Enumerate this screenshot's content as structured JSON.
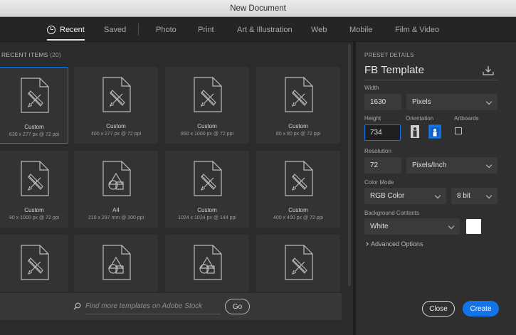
{
  "window": {
    "title": "New Document"
  },
  "tabs": [
    {
      "label": "Recent",
      "active": true
    },
    {
      "label": "Saved"
    },
    {
      "label": "Photo"
    },
    {
      "label": "Print"
    },
    {
      "label": "Art & Illustration"
    },
    {
      "label": "Web"
    },
    {
      "label": "Mobile"
    },
    {
      "label": "Film & Video"
    }
  ],
  "recent": {
    "header": "RECENT ITEMS",
    "count": "(20)",
    "items": [
      {
        "name": "Custom",
        "size": "630 x 277 px @ 72 ppi",
        "icon": "custom-doc-icon",
        "selected": true
      },
      {
        "name": "Custom",
        "size": "400 x 277 px @ 72 ppi",
        "icon": "custom-doc-icon"
      },
      {
        "name": "Custom",
        "size": "850 x 1000 px @ 72 ppi",
        "icon": "custom-doc-icon"
      },
      {
        "name": "Custom",
        "size": "80 x 80 px @ 72 ppi",
        "icon": "custom-doc-icon"
      },
      {
        "name": "Custom",
        "size": "90 x 1000 px @ 72 ppi",
        "icon": "custom-doc-icon"
      },
      {
        "name": "A4",
        "size": "210 x 297 mm @ 300 ppi",
        "icon": "print-doc-icon"
      },
      {
        "name": "Custom",
        "size": "1024 x 1024 px @ 144 ppi",
        "icon": "custom-doc-icon"
      },
      {
        "name": "Custom",
        "size": "400 x 400 px @ 72 ppi",
        "icon": "custom-doc-icon"
      },
      {
        "name": "",
        "size": "",
        "icon": "custom-doc-icon"
      },
      {
        "name": "",
        "size": "",
        "icon": "print-doc-icon"
      },
      {
        "name": "",
        "size": "",
        "icon": "print-doc-icon"
      },
      {
        "name": "",
        "size": "",
        "icon": "custom-doc-icon"
      }
    ]
  },
  "search": {
    "placeholder": "Find more templates on Adobe Stock",
    "go_label": "Go"
  },
  "preset": {
    "section_label": "PRESET DETAILS",
    "name": "FB Template",
    "width_label": "Width",
    "width_value": "1630",
    "width_unit": "Pixels",
    "height_label": "Height",
    "height_value": "734",
    "orientation_label": "Orientation",
    "artboards_label": "Artboards",
    "resolution_label": "Resolution",
    "resolution_value": "72",
    "resolution_unit": "Pixels/Inch",
    "color_mode_label": "Color Mode",
    "color_mode_value": "RGB Color",
    "bit_depth_value": "8 bit",
    "background_label": "Background Contents",
    "background_value": "White",
    "background_color": "#ffffff",
    "advanced_label": "Advanced Options"
  },
  "actions": {
    "close_label": "Close",
    "create_label": "Create"
  },
  "colors": {
    "accent": "#1473e6",
    "panel": "#2f2f2f",
    "card": "#333333"
  }
}
